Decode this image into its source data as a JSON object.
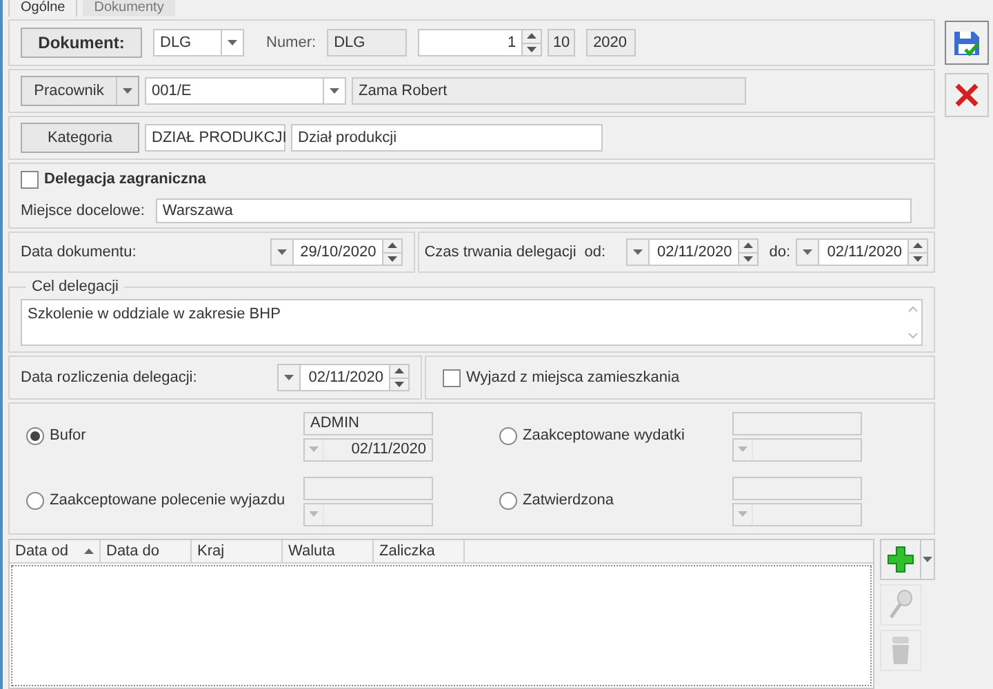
{
  "tabs": [
    {
      "label": "Ogólne",
      "selected": true
    },
    {
      "label": "Dokumenty",
      "selected": false
    }
  ],
  "document": {
    "button": "Dokument:",
    "type": "DLG",
    "number_label": "Numer:",
    "prefix": "DLG",
    "number": "1",
    "month": "10",
    "year": "2020"
  },
  "employee": {
    "button": "Pracownik",
    "code": "001/E",
    "name": "Zama Robert"
  },
  "category": {
    "button": "Kategoria",
    "code": "DZIAŁ PRODUKCJI",
    "description": "Dział produkcji"
  },
  "foreign": {
    "label": "Delegacja zagraniczna",
    "checked": false
  },
  "destination": {
    "label": "Miejsce docelowe:",
    "value": "Warszawa"
  },
  "document_date": {
    "label": "Data dokumentu:",
    "value": "29/10/2020"
  },
  "duration": {
    "label": "Czas trwania delegacji",
    "from_label": "od:",
    "from": "02/11/2020",
    "to_label": "do:",
    "to": "02/11/2020"
  },
  "purpose": {
    "legend": "Cel delegacji",
    "value": "Szkolenie w oddziale w zakresie BHP"
  },
  "settlement_date": {
    "label": "Data rozliczenia delegacji:",
    "value": "02/11/2020"
  },
  "departure_from_home": {
    "label": "Wyjazd z miejsca zamieszkania",
    "checked": false
  },
  "statuses": [
    {
      "label": "Bufor",
      "selected": true,
      "user": "ADMIN",
      "date": "02/11/2020"
    },
    {
      "label": "Zaakceptowane wydatki",
      "selected": false
    },
    {
      "label": "Zaakceptowane polecenie wyjazdu",
      "selected": false
    },
    {
      "label": "Zatwierdzona",
      "selected": false
    }
  ],
  "table": {
    "columns": [
      {
        "label": "Data od",
        "sorted": true
      },
      {
        "label": "Data do",
        "sorted": false
      },
      {
        "label": "Kraj",
        "sorted": false
      },
      {
        "label": "Waluta",
        "sorted": false
      },
      {
        "label": "Zaliczka",
        "sorted": false
      }
    ]
  }
}
